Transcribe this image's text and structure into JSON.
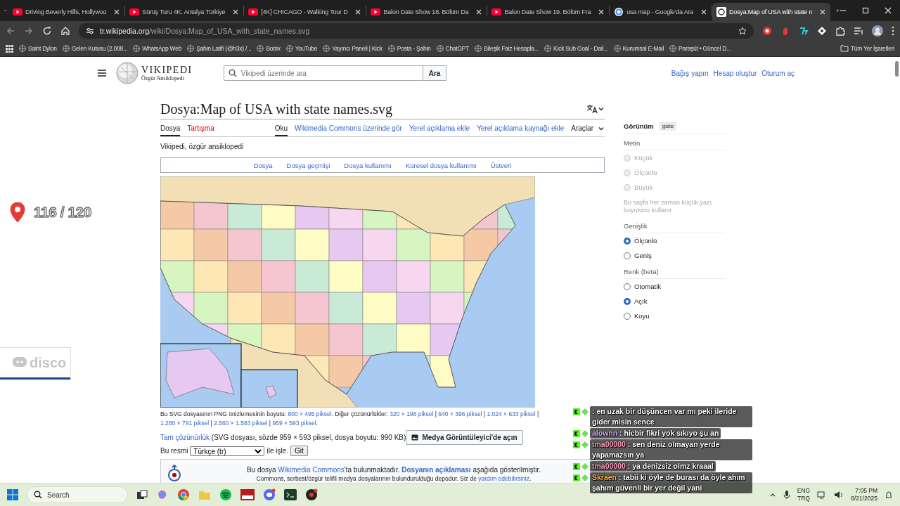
{
  "browser": {
    "tabs": [
      {
        "title": "Driving Beverly Hills, Hollywoo",
        "kind": "video",
        "selected": false
      },
      {
        "title": "Sürüş Turu 4K: Antalya Türkiye",
        "kind": "video",
        "selected": false
      },
      {
        "title": "[4K] CHICAGO - Walking Tour D",
        "kind": "video",
        "selected": false
      },
      {
        "title": "Balon Date Show 18. Bölüm Da",
        "kind": "video",
        "selected": false
      },
      {
        "title": "Balon Date Show 19. Bölüm Fra",
        "kind": "video",
        "selected": false
      },
      {
        "title": "usa map - Google'da Ara",
        "kind": "search",
        "selected": false
      },
      {
        "title": "Dosya:Map of USA with state n",
        "kind": "wiki",
        "selected": true
      }
    ],
    "address": {
      "host": "tr.wikipedia.org",
      "path": "/wiki/Dosya:Map_of_USA_with_state_names.svg"
    },
    "bookmarks": [
      "Saint Dylon",
      "Gelen Kutusu (2.008...",
      "WhatsApp Web",
      "Şahin Latifi (@h3x) /...",
      "Botrix",
      "YouTube",
      "Yayıncı Paneli | Kick",
      "Posta - Şahin",
      "ChatGPT",
      "Bileşik Faiz Hesapla...",
      "Kick Sub Goal - Dail...",
      "Kurumsal E-Mail",
      "Paraşüt • Güncel D..."
    ],
    "all_bookmarks": "Tüm Yer İşaretleri"
  },
  "wiki": {
    "logo": {
      "wordmark": "VIKIPEDI",
      "tagline": "Özgür Ansiklopedi"
    },
    "search": {
      "placeholder": "Vikipedi üzerinde ara",
      "button": "Ara"
    },
    "user_links": [
      "Bağış yapın",
      "Hesap oluştur",
      "Oturum aç"
    ],
    "title": "Dosya:Map of USA with state names.svg",
    "page_tabs": [
      {
        "label": "Dosya",
        "kind": "existing",
        "selected": true
      },
      {
        "label": "Tartışma",
        "kind": "new",
        "selected": false
      }
    ],
    "view_tabs": [
      {
        "label": "Oku",
        "kind": "link",
        "selected": true
      },
      {
        "label": "Wikimedia Commons üzerinde gör",
        "kind": "link",
        "selected": false
      },
      {
        "label": "Yerel açıklama ekle",
        "kind": "link",
        "selected": false
      },
      {
        "label": "Yerel açıklama kaynağı ekle",
        "kind": "link",
        "selected": false
      },
      {
        "label": "Araçlar",
        "kind": "menu",
        "selected": false
      }
    ],
    "tagline": "Vikipedi, özgür ansiklopedi",
    "file_tabs": [
      "Dosya",
      "Dosya geçmişi",
      "Dosya kullanımı",
      "Küresel dosya kullanımı",
      "Üstveri"
    ],
    "preview_line": [
      {
        "kind": "text",
        "text": "Bu SVG dosyasının PNG önizlemesinin boyutu: "
      },
      {
        "kind": "link",
        "text": "800 × 495 piksel"
      },
      {
        "kind": "text",
        "text": ". Diğer çözünürlükler: "
      },
      {
        "kind": "link",
        "text": "320 × 198 piksel"
      },
      {
        "kind": "text",
        "text": " | "
      },
      {
        "kind": "link",
        "text": "640 × 396 piksel"
      },
      {
        "kind": "text",
        "text": " | "
      },
      {
        "kind": "link",
        "text": "1.024 × 633 piksel"
      },
      {
        "kind": "text",
        "text": " | "
      },
      {
        "kind": "link",
        "text": "1.280 × 791 piksel"
      },
      {
        "kind": "text",
        "text": " | "
      },
      {
        "kind": "link",
        "text": "2.560 × 1.583 piksel"
      },
      {
        "kind": "text",
        "text": " | "
      },
      {
        "kind": "link",
        "text": "959 × 593 piksel"
      },
      {
        "kind": "text",
        "text": "."
      }
    ],
    "full_res": {
      "link": "Tam çözünürlük",
      "text": " (SVG dosyası, sözde 959 × 593 piksel, dosya boyutu: 990 KB)",
      "button": "Medya Görüntüleyici'de açın"
    },
    "edit_row": {
      "prefix": "Bu resmi",
      "select": "Türkçe (tr)",
      "suffix": "ile işle.",
      "button": "Git"
    },
    "commons_notice": {
      "line_1": [
        {
          "kind": "text",
          "text": "Bu dosya "
        },
        {
          "kind": "link",
          "text": "Wikimedia Commons"
        },
        {
          "kind": "text",
          "text": "'ta bulunmaktadır. "
        },
        {
          "kind": "bold_link",
          "text": "Dosyanın açıklaması"
        },
        {
          "kind": "text",
          "text": " aşağıda gösterilmiştir."
        }
      ],
      "line_2": [
        {
          "kind": "text",
          "text": "Commons, serbest/özgür telifli medya dosyalarının bulundurulduğu depodur. Siz de "
        },
        {
          "kind": "link",
          "text": "yardım edebilirsiniz"
        },
        {
          "kind": "text",
          "text": "."
        }
      ]
    }
  },
  "appearance": {
    "title": "Görünüm",
    "hide_button": "gizle",
    "sections": [
      {
        "heading": "Metin",
        "options": [
          {
            "label": "Küçük",
            "selected": false,
            "disabled": true
          },
          {
            "label": "Ölçünlü",
            "selected": false,
            "disabled": true
          },
          {
            "label": "Büyük",
            "selected": false,
            "disabled": true
          }
        ],
        "note": "Bu sayfa her zaman küçük yazı boyutunu kullanır"
      },
      {
        "heading": "Genişlik",
        "options": [
          {
            "label": "Ölçünlü",
            "selected": true,
            "disabled": false
          },
          {
            "label": "Geniş",
            "selected": false,
            "disabled": false
          }
        ]
      },
      {
        "heading": "Renk (beta)",
        "options": [
          {
            "label": "Otomatik",
            "selected": false,
            "disabled": false
          },
          {
            "label": "Açık",
            "selected": true,
            "disabled": false
          },
          {
            "label": "Koyu",
            "selected": false,
            "disabled": false
          }
        ]
      }
    ]
  },
  "overlay": {
    "counter": "116 / 120",
    "widget_text": "disco",
    "chat": [
      {
        "text": ": en uzak bir düşüncen var mı peki ileride gider misin sence"
      },
      {
        "user": "alownn",
        "color": "#d4b0ff",
        "text": ": hicbir fikri yok sıkıyo şu an"
      },
      {
        "user": "tma00000",
        "color": "#ffa0c0",
        "text": ": sen deniz olmayan yerde yapamazsın ya"
      },
      {
        "user": "tma00000",
        "color": "#ffa0c0",
        "text": ": ya denizsiz olmz kraaal"
      },
      {
        "user": "Skraen",
        "color": "#ffb347",
        "text": ": tabii ki öyle de burası da öyle ahım şahım güvenli bir yer değil yani"
      }
    ]
  },
  "taskbar": {
    "search": {
      "placeholder": "Search"
    },
    "language": [
      "ENG",
      "TRQ"
    ],
    "time": "7:05 PM",
    "date": "8/21/2025"
  }
}
